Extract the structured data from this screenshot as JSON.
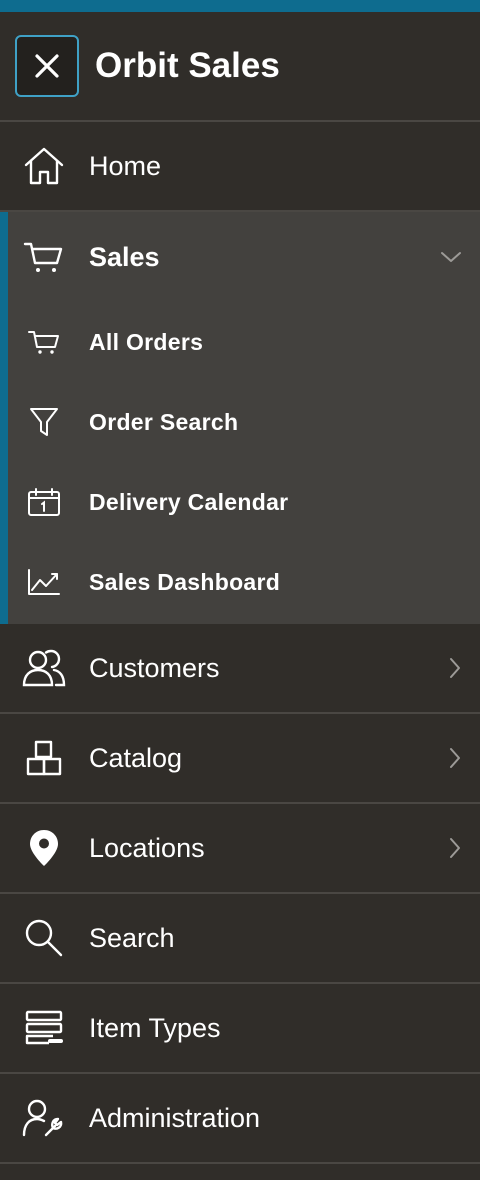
{
  "app": {
    "title": "Orbit Sales"
  },
  "nav": {
    "home": {
      "label": "Home",
      "icon": "home-icon"
    },
    "sales": {
      "label": "Sales",
      "icon": "cart-icon",
      "expanded": true,
      "children": [
        {
          "label": "All Orders",
          "icon": "cart-icon",
          "active": true
        },
        {
          "label": "Order Search",
          "icon": "filter-icon"
        },
        {
          "label": "Delivery Calendar",
          "icon": "calendar-icon"
        },
        {
          "label": "Sales Dashboard",
          "icon": "line-chart-icon"
        }
      ]
    },
    "customers": {
      "label": "Customers",
      "icon": "users-icon"
    },
    "catalog": {
      "label": "Catalog",
      "icon": "boxes-icon"
    },
    "locations": {
      "label": "Locations",
      "icon": "map-pin-icon"
    },
    "search": {
      "label": "Search",
      "icon": "search-icon"
    },
    "item_types": {
      "label": "Item Types",
      "icon": "stack-icon"
    },
    "administration": {
      "label": "Administration",
      "icon": "user-wrench-icon"
    }
  },
  "colors": {
    "accent": "#0e6c8f",
    "background": "#302d29",
    "group_bg": "#43413e",
    "focus_ring": "#3fa1c6"
  }
}
